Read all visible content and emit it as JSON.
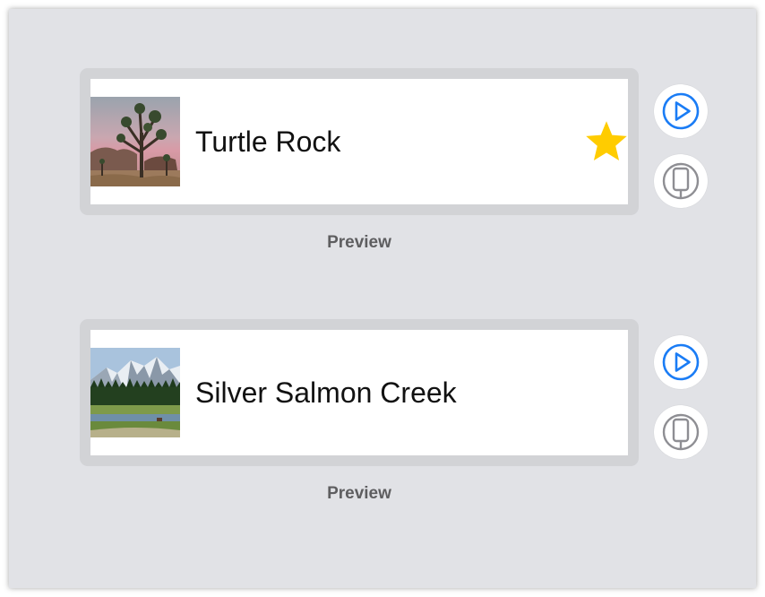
{
  "previews": [
    {
      "name": "Turtle Rock",
      "is_favorite": true,
      "thumbnail": "joshua-tree-desert-photo",
      "caption": "Preview",
      "live_button_icon": "play-circle-icon",
      "device_button_icon": "device-icon"
    },
    {
      "name": "Silver Salmon Creek",
      "is_favorite": false,
      "thumbnail": "snowy-mountain-meadow-photo",
      "caption": "Preview",
      "live_button_icon": "play-circle-icon",
      "device_button_icon": "device-icon"
    }
  ],
  "colors": {
    "canvas": "#e1e2e6",
    "frame": "#d2d3d6",
    "star": "#ffcc00",
    "play_accent": "#1a7cf5",
    "device_icon": "#8e8e93",
    "caption": "#5e5e60"
  }
}
